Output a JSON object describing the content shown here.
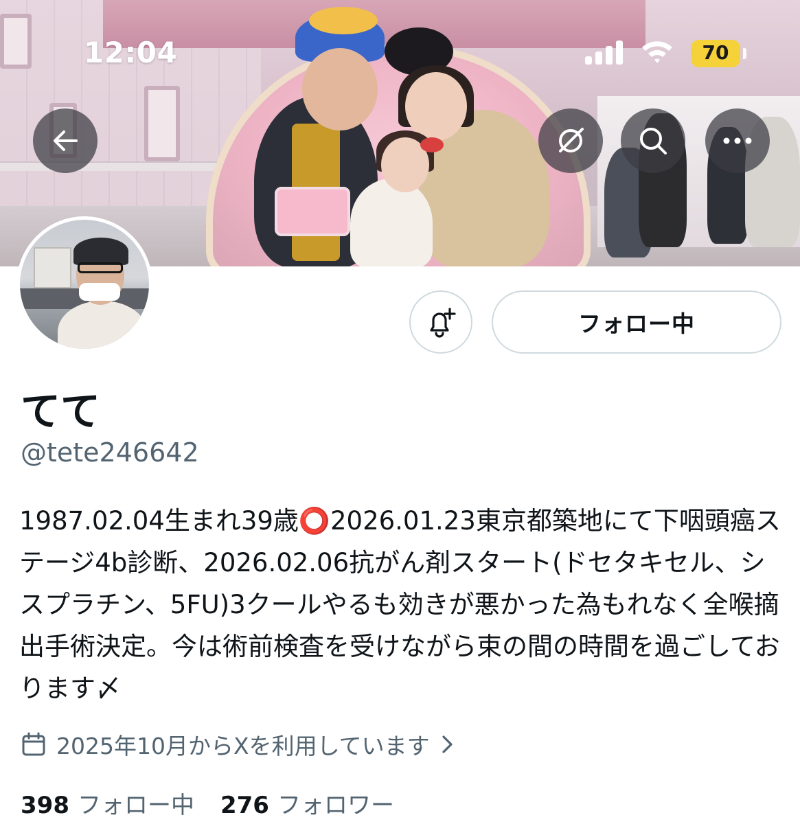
{
  "status_bar": {
    "time": "12:04",
    "battery_level": "70",
    "battery_color": "#f6d23a"
  },
  "header": {
    "back_icon": "arrow-left-icon",
    "grok_icon": "grok-icon",
    "search_icon": "search-icon",
    "more_icon": "more-horizontal-icon"
  },
  "profile": {
    "display_name": "てて",
    "handle": "@tete246642",
    "bio": "1987.02.04生まれ39歳⭕️2026.01.23東京都築地にて下咽頭癌ステージ4b診断、2026.02.06抗がん剤スタート(ドセタキセル、シスプラチン、5FU)3クールやるも効きが悪かった為もれなく全喉摘出手術決定。今は術前検査を受けながら束の間の時間を過ごしております〆",
    "joined": "2025年10月からXを利用しています",
    "following_count": "398",
    "following_label": "フォロー中",
    "followers_count": "276",
    "followers_label": "フォロワー"
  },
  "actions": {
    "notify_icon": "bell-plus-icon",
    "follow_button_label": "フォロー中"
  },
  "colors": {
    "text_primary": "#0f1419",
    "text_secondary": "#536471",
    "border": "#cfd9de"
  }
}
